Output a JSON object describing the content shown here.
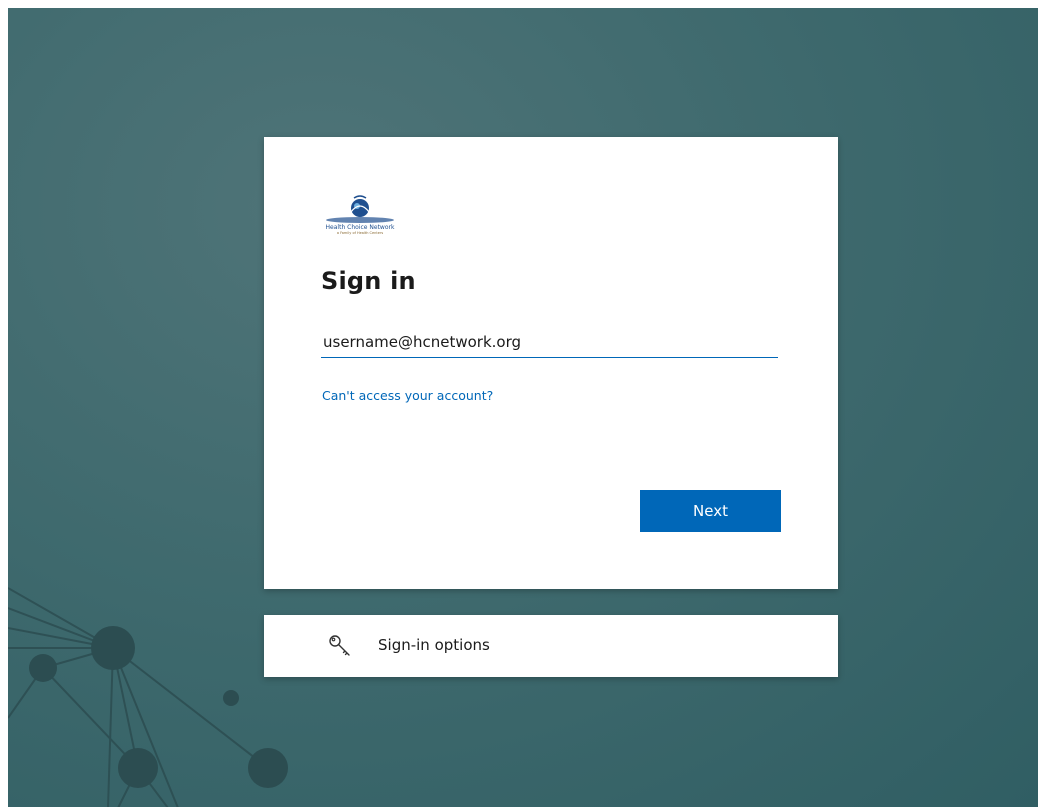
{
  "logo": {
    "name": "Health Choice Network",
    "tagline": "a Family of Health Centers"
  },
  "signin": {
    "title": "Sign in",
    "email_value": "username@hcnetwork.org",
    "cant_access_link": "Can't access your account?",
    "next_label": "Next"
  },
  "options": {
    "label": "Sign-in options",
    "icon": "key-icon"
  },
  "colors": {
    "accent": "#0067b8",
    "background": "#3f6a6e"
  }
}
